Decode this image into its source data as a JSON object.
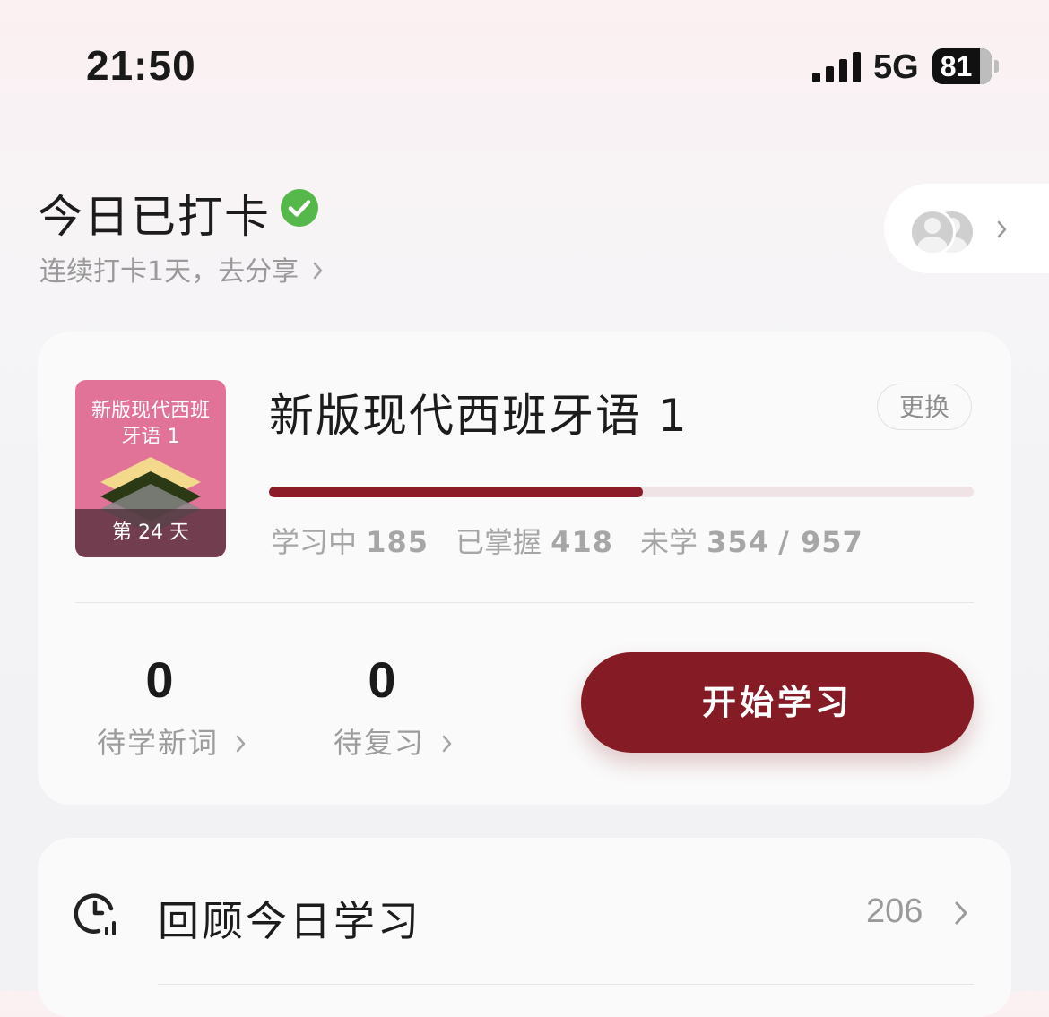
{
  "status_bar": {
    "time": "21:50",
    "network": "5G",
    "battery": "81"
  },
  "checkin": {
    "title": "今日已打卡",
    "streak_text": "连续打卡1天，去分享",
    "success_color": "#56b84a"
  },
  "friends": {
    "icon": "friends-avatars-icon"
  },
  "book": {
    "cover_title": "新版现代西班牙语 1",
    "cover_day": "第 24 天",
    "cover_color": "#e27398",
    "title": "新版现代西班牙语 1",
    "change_label": "更换",
    "progress": 0.53,
    "accent_color": "#841b25",
    "stats": {
      "learning_label": "学习中",
      "learning": "185",
      "mastered_label": "已掌握",
      "mastered": "418",
      "unlearned_label": "未学",
      "unlearned": "354",
      "total": "/ 957"
    }
  },
  "tasks": {
    "new_words_count": "0",
    "new_words_label": "待学新词",
    "review_count": "0",
    "review_label": "待复习",
    "start_label": "开始学习"
  },
  "review_today": {
    "label": "回顾今日学习",
    "count": "206",
    "icon": "clock-stats-icon"
  }
}
